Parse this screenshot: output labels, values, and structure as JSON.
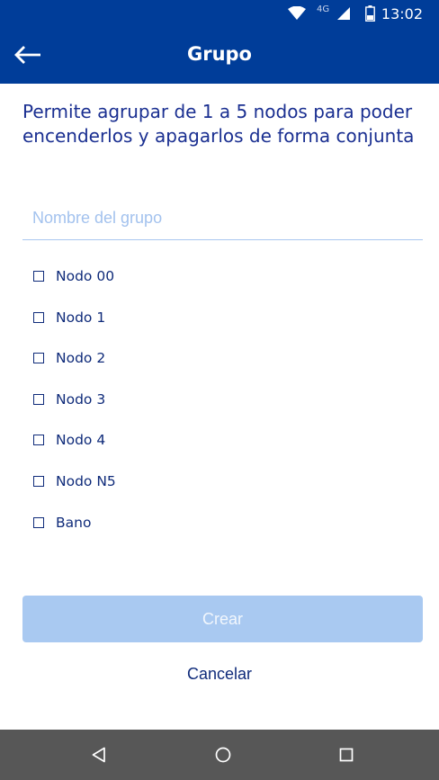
{
  "status_bar": {
    "network": "4G",
    "time": "13:02",
    "icons": [
      "wifi-icon",
      "signal-icon",
      "battery-icon"
    ]
  },
  "app_bar": {
    "title": "Grupo",
    "back_icon": "arrow-back-icon"
  },
  "description": "Permite agrupar de 1 a 5 nodos para poder encenderlos y apagarlos de forma conjunta",
  "group_name": {
    "value": "",
    "placeholder": "Nombre del grupo"
  },
  "nodes": [
    {
      "label": "Nodo 00",
      "checked": false
    },
    {
      "label": "Nodo 1",
      "checked": false
    },
    {
      "label": "Nodo 2",
      "checked": false
    },
    {
      "label": "Nodo 3",
      "checked": false
    },
    {
      "label": "Nodo 4",
      "checked": false
    },
    {
      "label": "Nodo N5",
      "checked": false
    },
    {
      "label": "Bano",
      "checked": false
    }
  ],
  "actions": {
    "create_label": "Crear",
    "cancel_label": "Cancelar"
  },
  "navigation": {
    "icons": [
      "back-triangle-icon",
      "home-circle-icon",
      "recents-square-icon"
    ]
  },
  "colors": {
    "primary": "#003d99",
    "text": "#1a2f91",
    "button_disabled": "#a9c9f1",
    "nav_bar": "#575757"
  }
}
